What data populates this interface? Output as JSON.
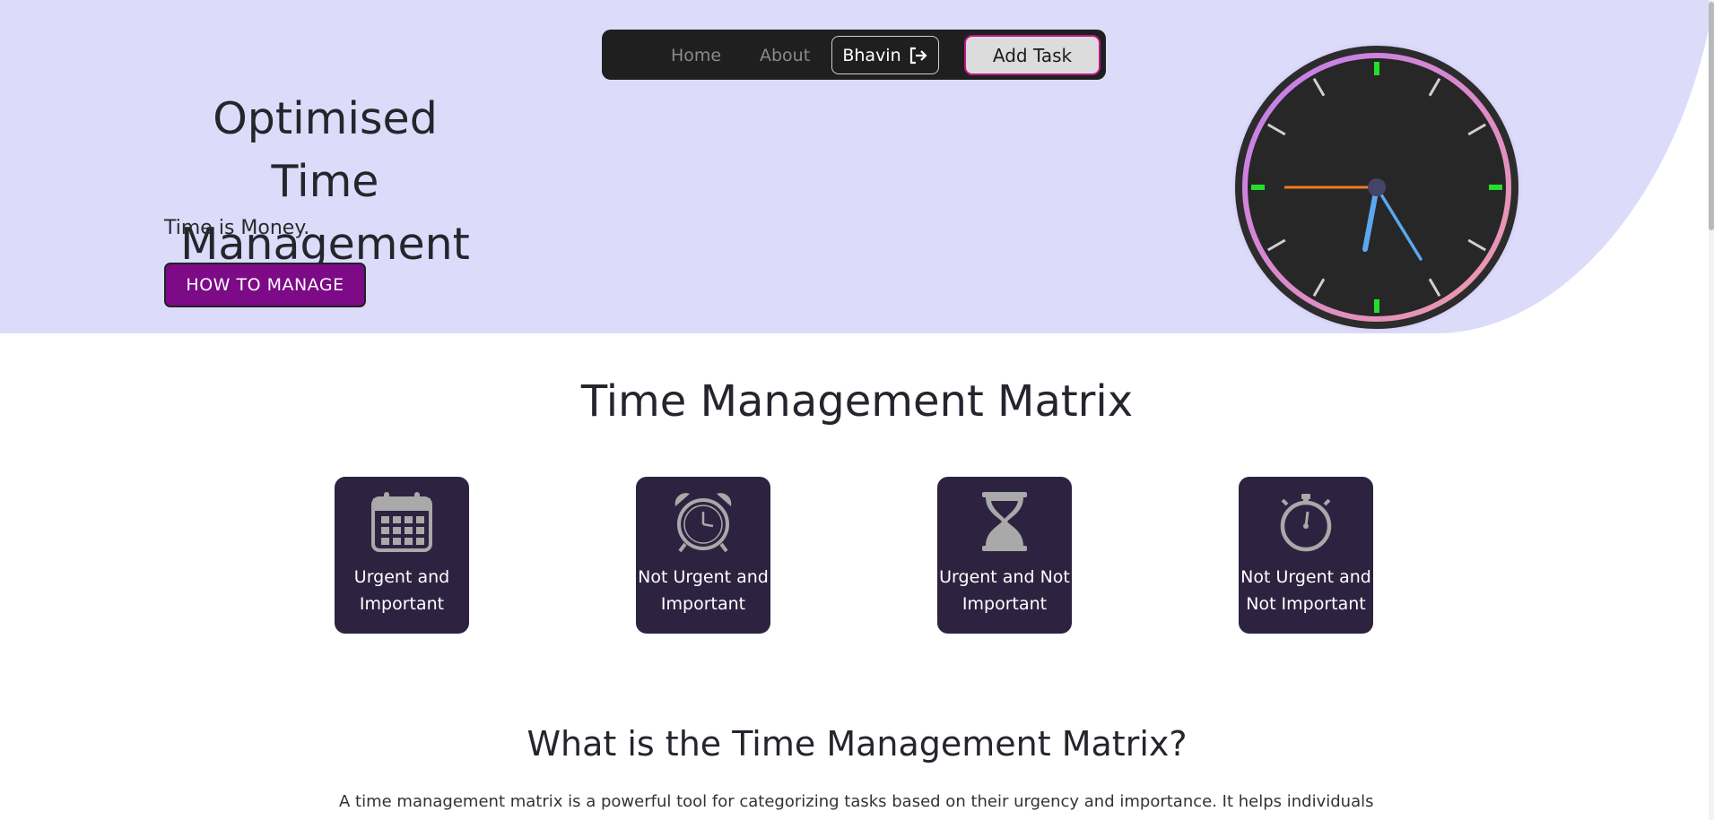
{
  "nav": {
    "home": "Home",
    "about": "About",
    "user": "Bhavin",
    "add_task": "Add Task"
  },
  "hero": {
    "title": "Optimised Time Management",
    "subtitle": "Time is Money.",
    "button": "HOW TO MANAGE"
  },
  "matrix": {
    "title": "Time Management Matrix",
    "cards": [
      {
        "label": "Urgent and Important",
        "icon": "calendar-icon"
      },
      {
        "label": "Not Urgent and Important",
        "icon": "alarm-clock-icon"
      },
      {
        "label": "Urgent and Not Important",
        "icon": "hourglass-icon"
      },
      {
        "label": "Not Urgent and Not Important",
        "icon": "stopwatch-icon"
      }
    ]
  },
  "what": {
    "title": "What is the Time Management Matrix?",
    "text": "A time management matrix is a powerful tool for categorizing tasks based on their urgency and importance. It helps individuals"
  },
  "colors": {
    "hero_bg": "#dcdcfa",
    "nav_bg": "#1f1f1f",
    "button_purple": "#7d0a86",
    "card_bg": "#2d2341"
  }
}
